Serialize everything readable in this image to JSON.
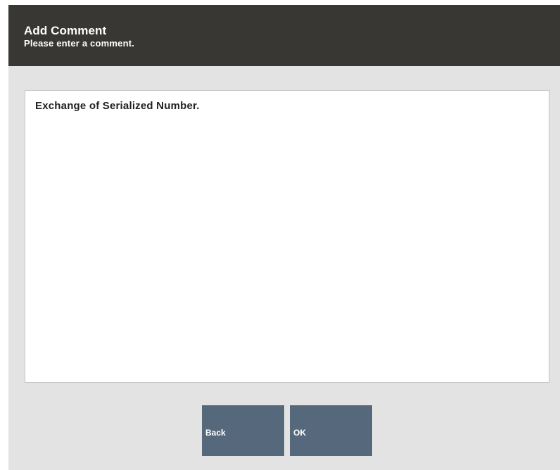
{
  "dialog": {
    "title": "Add Comment",
    "subtitle": "Please enter a comment."
  },
  "comment": {
    "value": "Exchange of Serialized Number."
  },
  "buttons": {
    "back_label": "Back",
    "ok_label": "OK"
  },
  "colors": {
    "header_background": "#393734",
    "dialog_background": "#e3e3e3",
    "button_background": "#56687b"
  }
}
